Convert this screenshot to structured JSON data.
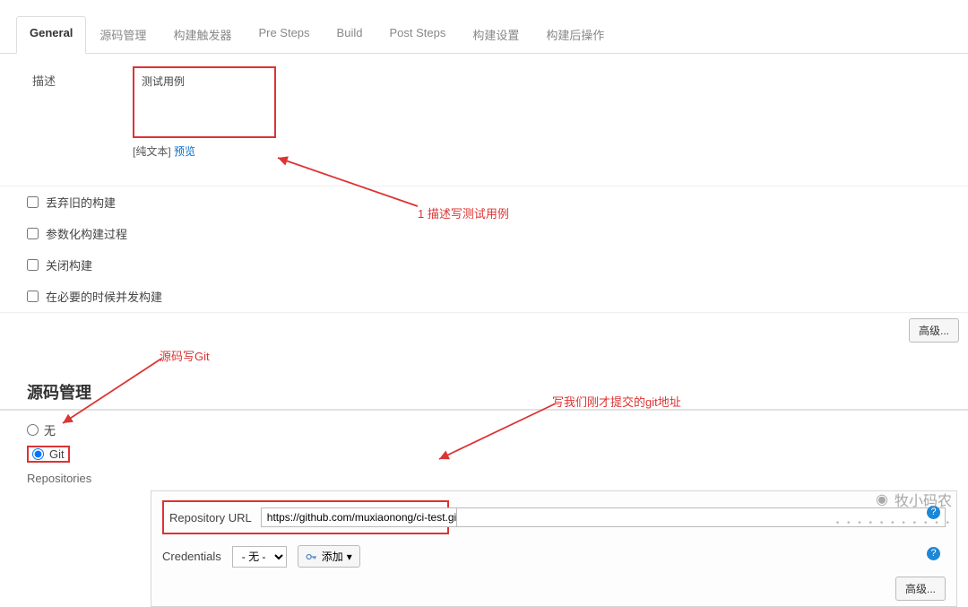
{
  "tabs": [
    {
      "label": "General",
      "active": true
    },
    {
      "label": "源码管理"
    },
    {
      "label": "构建触发器"
    },
    {
      "label": "Pre Steps"
    },
    {
      "label": "Build"
    },
    {
      "label": "Post Steps"
    },
    {
      "label": "构建设置"
    },
    {
      "label": "构建后操作"
    }
  ],
  "description": {
    "label": "描述",
    "value": "测试用例",
    "plain_text": "[纯文本]",
    "preview": "预览"
  },
  "checkboxes": [
    {
      "label": "丢弃旧的构建"
    },
    {
      "label": "参数化构建过程"
    },
    {
      "label": "关闭构建"
    },
    {
      "label": "在必要的时候并发构建"
    }
  ],
  "advanced_button": "高级...",
  "scm": {
    "title": "源码管理",
    "options": [
      {
        "label": "无",
        "selected": false
      },
      {
        "label": "Git",
        "selected": true
      }
    ],
    "repositories_label": "Repositories",
    "repo_url_label": "Repository URL",
    "repo_url_value": "https://github.com/muxiaonong/ci-test.git",
    "credentials_label": "Credentials",
    "credentials_value": "- 无 -",
    "add_button": "添加"
  },
  "annotations": {
    "a1": "1 描述写测试用例",
    "a2": "源码写Git",
    "a3": "写我们刚才提交的git地址"
  },
  "watermark": "牧小码农"
}
